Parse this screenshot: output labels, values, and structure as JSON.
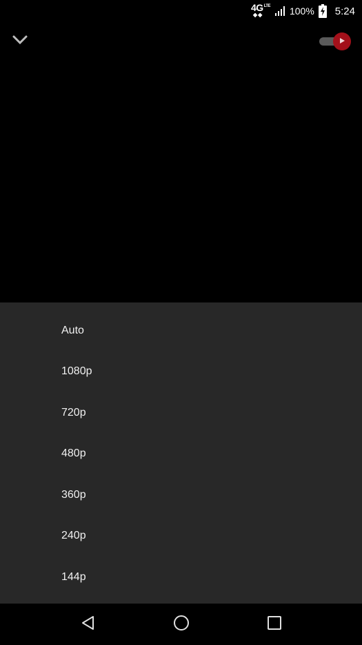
{
  "status_bar": {
    "network_type": "4G",
    "network_sub": "LTE",
    "battery_percent": "100%",
    "time": "5:24"
  },
  "player": {
    "collapse_icon": "chevron-down-icon",
    "autoplay_icon": "play-icon",
    "autoplay_on": true,
    "accent_color": "#a3101a"
  },
  "quality_menu": {
    "options": [
      "Auto",
      "1080p",
      "720p",
      "480p",
      "360p",
      "240p",
      "144p"
    ]
  },
  "nav_bar": {
    "back_icon": "back-triangle-icon",
    "home_icon": "home-circle-icon",
    "recents_icon": "recents-square-icon"
  }
}
